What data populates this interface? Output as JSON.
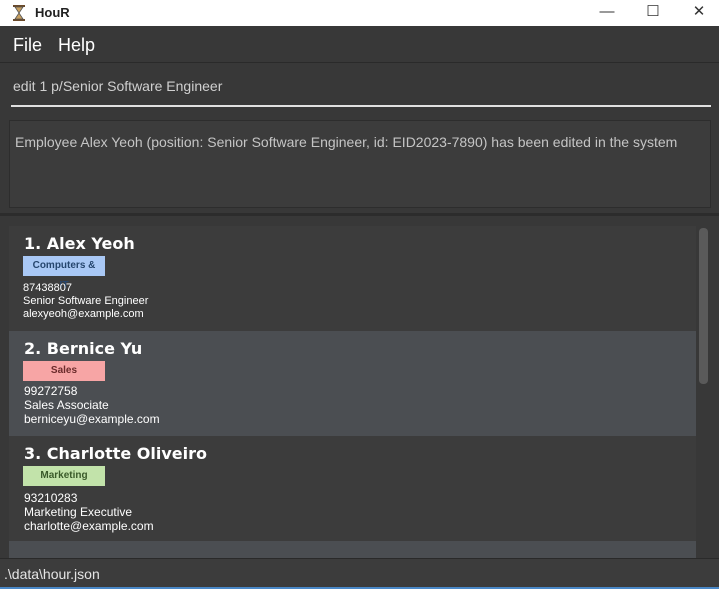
{
  "window": {
    "title": "HouR"
  },
  "menu": {
    "file": "File",
    "help": "Help"
  },
  "command": {
    "value": "edit 1 p/Senior Software Engineer"
  },
  "result": {
    "message": "Employee Alex Yeoh (position: Senior Software Engineer, id: EID2023-7890) has been edited in the system"
  },
  "employees": [
    {
      "name": "1.  Alex Yeoh",
      "tag": "Computers & IT",
      "phone": "87438807",
      "position": "Senior Software Engineer",
      "email": "alexyeoh@example.com"
    },
    {
      "name": "2.  Bernice Yu",
      "tag": "Sales",
      "phone": "99272758",
      "position": "Sales Associate",
      "email": "berniceyu@example.com"
    },
    {
      "name": "3.  Charlotte Oliveiro",
      "tag": "Marketing",
      "phone": "93210283",
      "position": "Marketing Executive",
      "email": "charlotte@example.com"
    }
  ],
  "status": {
    "path": ".\\data\\hour.json"
  },
  "colors": {
    "accent": "#4a88c7",
    "background": "#383838",
    "tag_it": "#a9c8f5",
    "tag_sales": "#f7a5a5",
    "tag_marketing": "#c2e3aa"
  }
}
